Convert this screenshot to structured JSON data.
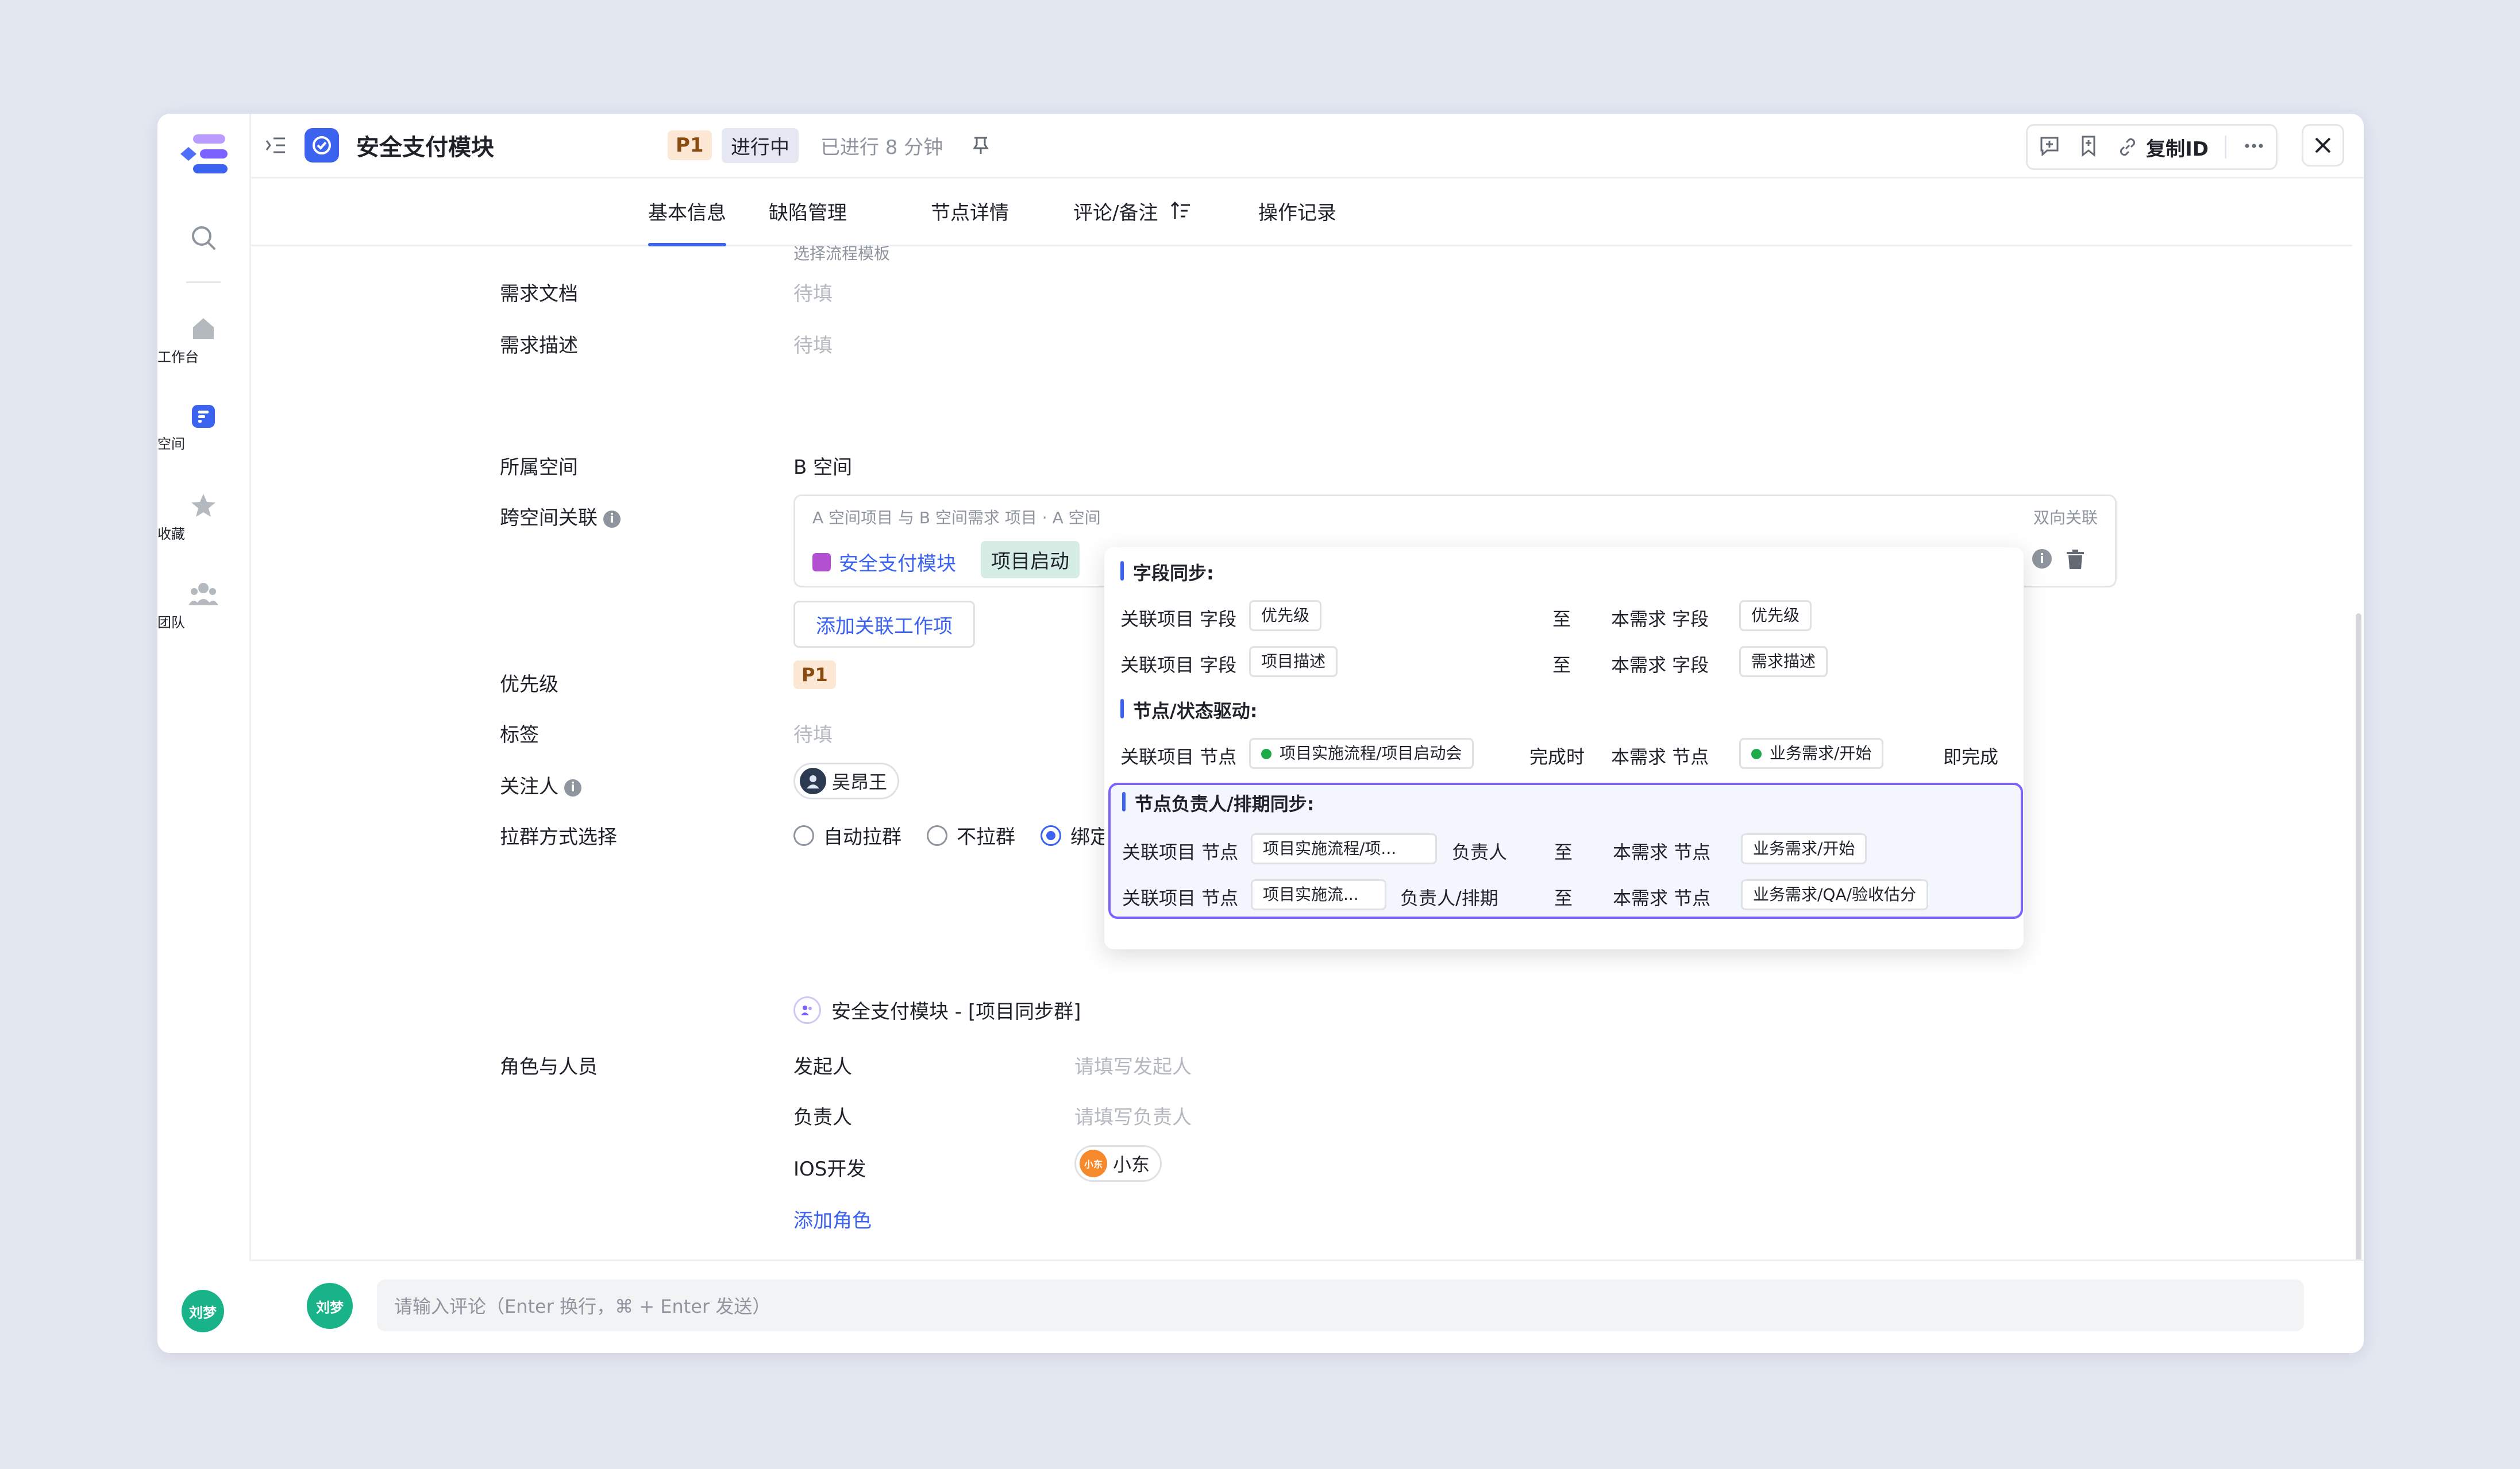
{
  "rail": {
    "workbench": "工作台",
    "space": "空间",
    "favorites": "收藏",
    "team": "团队",
    "user_avatar": "刘梦"
  },
  "header": {
    "title": "安全支付模块",
    "priority": "P1",
    "status": "进行中",
    "elapsed": "已进行 8 分钟",
    "copy_id": "复制ID"
  },
  "tabs": [
    {
      "label": "基本信息"
    },
    {
      "label": "缺陷管理"
    },
    {
      "label": "节点详情"
    },
    {
      "label": "评论/备注"
    },
    {
      "label": "操作记录"
    }
  ],
  "form": {
    "template_hint": "选择流程模板",
    "req_doc_label": "需求文档",
    "req_doc_value": "待填",
    "req_desc_label": "需求描述",
    "req_desc_value": "待填",
    "space_label": "所属空间",
    "space_value": "B 空间",
    "cross_label": "跨空间关联",
    "cross_box_title": "A 空间项目 与 B 空间需求  项目 · A 空间",
    "cross_box_right": "双向关联",
    "linked_item": "安全支付模块",
    "linked_node": "项目启动",
    "add_link": "添加关联工作项",
    "priority_label": "优先级",
    "priority_value": "P1",
    "tags_label": "标签",
    "tags_value": "待填",
    "watcher_label": "关注人",
    "watcher_name": "吴昂王",
    "group_label": "拉群方式选择",
    "group_opt1": "自动拉群",
    "group_opt2": "不拉群",
    "group_opt3": "绑定",
    "group_name": "安全支付模块 - [项目同步群]",
    "roles_label": "角色与人员",
    "role1": "发起人",
    "role1_ph": "请填写发起人",
    "role2": "负责人",
    "role2_ph": "请填写负责人",
    "role3": "IOS开发",
    "role3_user": "小东",
    "role3_avatar": "小东",
    "add_role": "添加角色"
  },
  "popover": {
    "sec1": "字段同步:",
    "sec2": "节点/状态驱动:",
    "sec3": "节点负责人/排期同步:",
    "rows": [
      {
        "left": "关联项目 字段",
        "left_tag": "优先级",
        "mid": "",
        "to": "至",
        "right": "本需求 字段",
        "right_tag": "优先级",
        "end": ""
      },
      {
        "left": "关联项目 字段",
        "left_tag": "项目描述",
        "mid": "",
        "to": "至",
        "right": "本需求 字段",
        "right_tag": "需求描述",
        "end": ""
      },
      {
        "left": "关联项目 节点",
        "left_tag": "项目实施流程/项目启动会",
        "mid": "",
        "to": "完成时",
        "right": "本需求 节点",
        "right_tag": "业务需求/开始",
        "end": "即完成"
      },
      {
        "left": "关联项目 节点",
        "left_tag": "项目实施流程/项...",
        "mid": "负责人",
        "to": "至",
        "right": "本需求 节点",
        "right_tag": "业务需求/开始",
        "end": ""
      },
      {
        "left": "关联项目 节点",
        "left_tag": "项目实施流...",
        "mid": "负责人/排期",
        "to": "至",
        "right": "本需求 节点",
        "right_tag": "业务需求/QA/验收估分",
        "end": ""
      }
    ]
  },
  "comment": {
    "avatar": "刘梦",
    "placeholder": "请输入评论（Enter 换行，⌘ + Enter 发送）"
  },
  "colors": {
    "accent": "#3c63f0",
    "avatar_green": "#19b38a",
    "highlight_border": "#7b61ff"
  }
}
